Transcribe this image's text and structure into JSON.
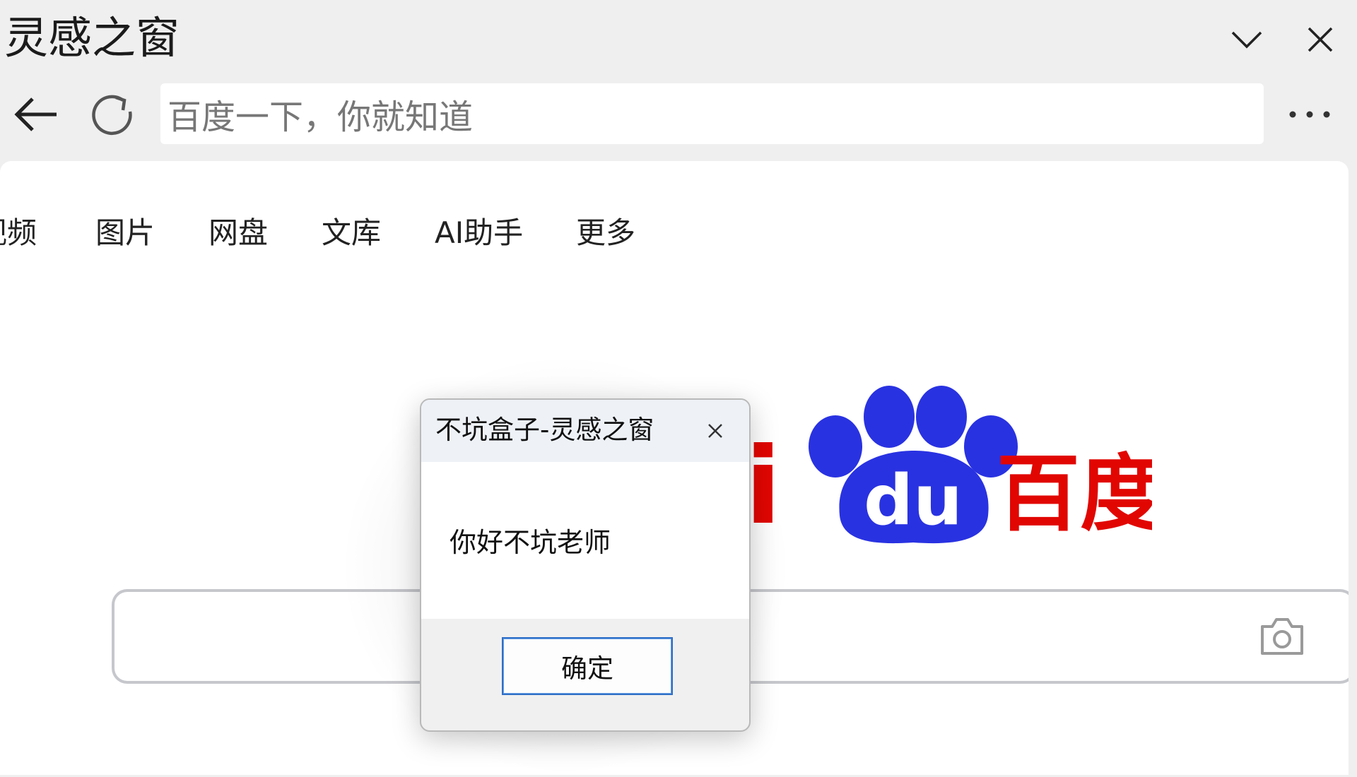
{
  "window": {
    "title": "灵感之窗",
    "collapse_icon": "chevron-down-icon",
    "close_icon": "close-icon"
  },
  "nav": {
    "back_icon": "arrow-left-icon",
    "refresh_icon": "refresh-icon",
    "address_text": "百度一下，你就知道",
    "more_icon": "more-horizontal-icon"
  },
  "page": {
    "tabs": [
      {
        "label": "视频"
      },
      {
        "label": "图片"
      },
      {
        "label": "网盘"
      },
      {
        "label": "文库"
      },
      {
        "label": "AI助手"
      },
      {
        "label": "更多"
      }
    ],
    "logo": {
      "text_du": "du",
      "text_cn": "百度",
      "text_partial": "i",
      "brand_red": "#e10602",
      "brand_blue": "#2932e1"
    },
    "camera_icon": "camera-icon",
    "search_border_color": "#c6c7cc",
    "search_accent_color": "#4e6ef2"
  },
  "dialog": {
    "title": "不坑盒子-灵感之窗",
    "message": "你好不坑老师",
    "ok_label": "确定",
    "close_icon": "close-icon"
  }
}
